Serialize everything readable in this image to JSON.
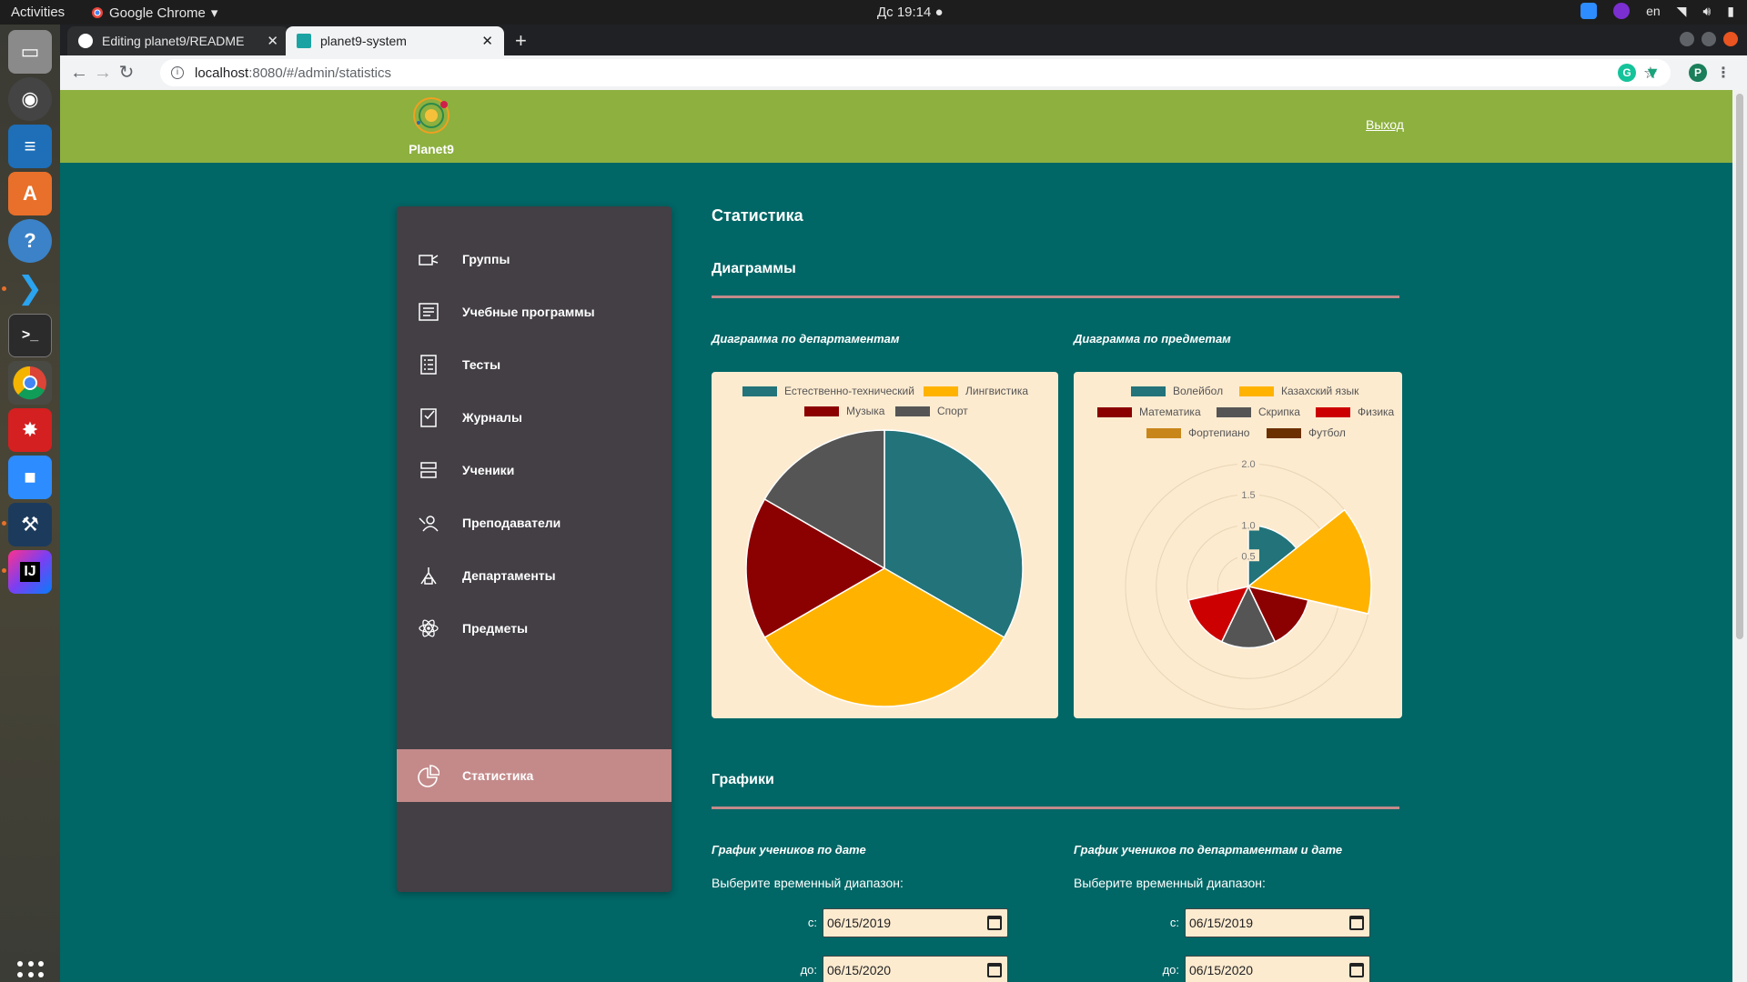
{
  "os": {
    "activities": "Activities",
    "app_name": "Google Chrome",
    "clock": "Дс 19:14 ●",
    "lang": "en"
  },
  "browser": {
    "tabs": [
      {
        "label": "Editing planet9/README",
        "active": false
      },
      {
        "label": "planet9-system",
        "active": true
      }
    ],
    "url_host": "localhost",
    "url_path": ":8080/#/admin/statistics",
    "profile_initial": "P"
  },
  "app": {
    "logo_name": "Planet9",
    "logout_label": "Выход",
    "menu": [
      {
        "label": "Группы",
        "icon": "groups-icon",
        "active": false
      },
      {
        "label": "Учебные программы",
        "icon": "curriculum-icon",
        "active": false
      },
      {
        "label": "Тесты",
        "icon": "tests-icon",
        "active": false
      },
      {
        "label": "Журналы",
        "icon": "journals-icon",
        "active": false
      },
      {
        "label": "Ученики",
        "icon": "students-icon",
        "active": false
      },
      {
        "label": "Преподаватели",
        "icon": "teachers-icon",
        "active": false
      },
      {
        "label": "Департаменты",
        "icon": "departments-icon",
        "active": false
      },
      {
        "label": "Предметы",
        "icon": "subjects-atom-icon",
        "active": false
      },
      {
        "label": "Статистика",
        "icon": "statistics-pie-icon",
        "active": true
      }
    ]
  },
  "page": {
    "title": "Статистика",
    "diagrams_heading": "Диаграммы",
    "graphs_heading": "Графики",
    "dept_chart_title": "Диаграмма по департаментам",
    "subj_chart_title": "Диаграмма по предметам",
    "graph1_title": "График учеников по дате",
    "graph2_title": "График учеников по департаментам и дате",
    "range_prompt": "Выберите временный диапазон:",
    "from_label": "с:",
    "to_label": "до:",
    "graph1_from": "06/15/2019",
    "graph1_to": "06/15/2020",
    "graph2_from": "06/15/2019",
    "graph2_to": "06/15/2020"
  },
  "chart_data": [
    {
      "type": "pie",
      "title": "Диаграмма по департаментам",
      "legend_position": "top",
      "categories": [
        "Естественно-технический",
        "Лингвистика",
        "Музыка",
        "Спорт"
      ],
      "values": [
        1,
        1,
        0.5,
        0.5
      ],
      "colors": [
        "#22737a",
        "#ffb300",
        "#8b0000",
        "#555555"
      ]
    },
    {
      "type": "polarArea",
      "title": "Диаграмма по предметам",
      "legend_position": "top",
      "categories": [
        "Волейбол",
        "Казахский язык",
        "Математика",
        "Скрипка",
        "Физика",
        "Фортепиано",
        "Футбол"
      ],
      "values": [
        1,
        2,
        1,
        1,
        1,
        0,
        0
      ],
      "colors": [
        "#22737a",
        "#ffb300",
        "#8b0000",
        "#555555",
        "#cc0000",
        "#c8861a",
        "#6b3000"
      ],
      "rmax": 2.0,
      "ticks": [
        "0.5",
        "1.0",
        "1.5",
        "2.0"
      ]
    }
  ]
}
